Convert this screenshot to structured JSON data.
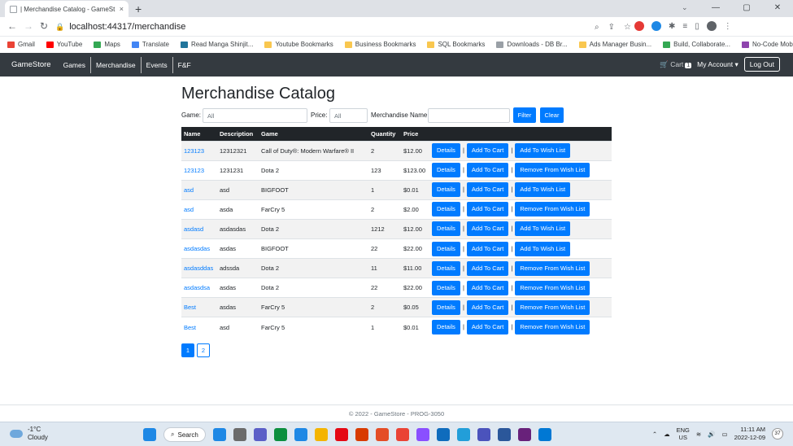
{
  "browser": {
    "tab_title": "| Merchandise Catalog - GameSt",
    "tab_close": "×",
    "new_tab": "+",
    "url": "localhost:44317/merchandise",
    "window_controls": [
      "⌄",
      "—",
      "▢",
      "✕"
    ],
    "bookmarks": [
      {
        "label": "Gmail",
        "icon": "gmail-icon",
        "color": "#ea4335"
      },
      {
        "label": "YouTube",
        "icon": "youtube-icon",
        "color": "#ff0000"
      },
      {
        "label": "Maps",
        "icon": "maps-icon",
        "color": "#34a853"
      },
      {
        "label": "Translate",
        "icon": "translate-icon",
        "color": "#4285f4"
      },
      {
        "label": "Read Manga Shinjit...",
        "icon": "wordpress-icon",
        "color": "#21759b"
      },
      {
        "label": "Youtube Bookmarks",
        "icon": "folder-icon",
        "color": "#f9c74f"
      },
      {
        "label": "Business Bookmarks",
        "icon": "folder-icon",
        "color": "#f9c74f"
      },
      {
        "label": "SQL Bookmarks",
        "icon": "folder-icon",
        "color": "#f9c74f"
      },
      {
        "label": "Downloads - DB Br...",
        "icon": "page-icon",
        "color": "#9aa0a6"
      },
      {
        "label": "Ads Manager Busin...",
        "icon": "folder-icon",
        "color": "#f9c74f"
      },
      {
        "label": "Build, Collaborate...",
        "icon": "build-icon",
        "color": "#34a853"
      },
      {
        "label": "No-Code Mobile A...",
        "icon": "nocode-icon",
        "color": "#8e44ad"
      }
    ],
    "more_bookmarks": "»"
  },
  "navbar": {
    "brand": "GameStore",
    "links": [
      "Games",
      "Merchandise",
      "Events",
      "F&F"
    ],
    "cart_label": "Cart",
    "cart_count": "1",
    "account_label": "My Account ▾",
    "logout_label": "Log Out"
  },
  "page": {
    "title": "Merchandise Catalog",
    "filters": {
      "game_label": "Game:",
      "game_placeholder": "All",
      "price_label": "Price:",
      "price_placeholder": "All",
      "merch_label": "Merchandise Name:",
      "merch_value": "",
      "filter_button": "Filter",
      "clear_button": "Clear"
    },
    "table": {
      "headers": [
        "Name",
        "Description",
        "Game",
        "Quantity",
        "Price",
        ""
      ],
      "rows": [
        {
          "name": "123123",
          "description": "12312321",
          "game": "Call of Duty®: Modern Warfare® II",
          "quantity": "2",
          "price": "$12.00",
          "wish": "Add To Wish List"
        },
        {
          "name": "123123",
          "description": "1231231",
          "game": "Dota 2",
          "quantity": "123",
          "price": "$123.00",
          "wish": "Remove From Wish List"
        },
        {
          "name": "asd",
          "description": "asd",
          "game": "BIGFOOT",
          "quantity": "1",
          "price": "$0.01",
          "wish": "Add To Wish List"
        },
        {
          "name": "asd",
          "description": "asda",
          "game": "FarCry 5",
          "quantity": "2",
          "price": "$2.00",
          "wish": "Remove From Wish List"
        },
        {
          "name": "asdasd",
          "description": "asdasdas",
          "game": "Dota 2",
          "quantity": "1212",
          "price": "$12.00",
          "wish": "Add To Wish List"
        },
        {
          "name": "asdasdas",
          "description": "asdas",
          "game": "BIGFOOT",
          "quantity": "22",
          "price": "$22.00",
          "wish": "Add To Wish List"
        },
        {
          "name": "asdasddas",
          "description": "adssda",
          "game": "Dota 2",
          "quantity": "11",
          "price": "$11.00",
          "wish": "Remove From Wish List"
        },
        {
          "name": "asdasdsa",
          "description": "asdas",
          "game": "Dota 2",
          "quantity": "22",
          "price": "$22.00",
          "wish": "Remove From Wish List"
        },
        {
          "name": "Best",
          "description": "asdas",
          "game": "FarCry 5",
          "quantity": "2",
          "price": "$0.05",
          "wish": "Remove From Wish List"
        },
        {
          "name": "Best",
          "description": "asd",
          "game": "FarCry 5",
          "quantity": "1",
          "price": "$0.01",
          "wish": "Remove From Wish List"
        }
      ],
      "details_label": "Details",
      "cart_label": "Add To Cart",
      "separator": "|"
    },
    "pagination": [
      "1",
      "2"
    ],
    "pagination_active": "1",
    "footer": "© 2022 - GameStore - PROG-3050"
  },
  "taskbar": {
    "temperature": "-1°C",
    "condition": "Cloudy",
    "search_label": "Search",
    "language": "ENG",
    "region": "US",
    "time": "11:11 AM",
    "date": "2022-12-09",
    "notification_count": "37",
    "app_colors": [
      "#1e88e5",
      "#6b6b6b",
      "#5b5fc7",
      "#0c8f3f",
      "#1e88e5",
      "#f4b400",
      "#e50914",
      "#d83b01",
      "#e44d26",
      "#ea4335",
      "#8a4fff",
      "#0f6cbd",
      "#229ed9",
      "#4b53bc",
      "#2b579a",
      "#68217a",
      "#0078d4"
    ]
  },
  "colors": {
    "primary": "#007bff",
    "navbar_bg": "#343a40",
    "table_header_bg": "#212529"
  }
}
